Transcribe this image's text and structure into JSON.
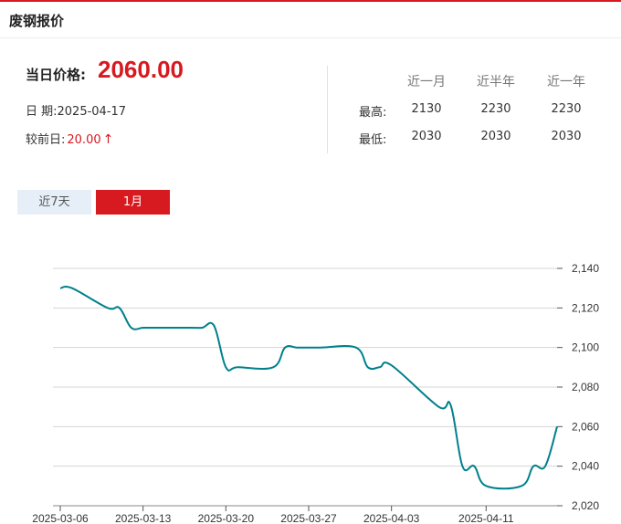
{
  "header": {
    "title": "废钢报价"
  },
  "price": {
    "label": "当日价格:",
    "value": "2060.00"
  },
  "date": {
    "label": "日 期:",
    "value": "2025-04-17"
  },
  "change": {
    "label": "较前日:",
    "value": "20.00",
    "arrow": "↑",
    "color": "#d71920"
  },
  "stats": {
    "columns": [
      "近一月",
      "近半年",
      "近一年"
    ],
    "rows": [
      {
        "label": "最高:",
        "values": [
          "2130",
          "2230",
          "2230"
        ]
      },
      {
        "label": "最低:",
        "values": [
          "2030",
          "2030",
          "2030"
        ]
      }
    ]
  },
  "tabs": [
    {
      "label": "近7天",
      "active": false
    },
    {
      "label": "1月",
      "active": true
    }
  ],
  "colors": {
    "accent": "#d71920",
    "line": "#00808b",
    "tab_inactive": "#e6eef7"
  },
  "chart_data": {
    "type": "line",
    "title": "",
    "xlabel": "",
    "ylabel": "",
    "ylim": [
      2020,
      2140
    ],
    "yticks": [
      2020,
      2040,
      2060,
      2080,
      2100,
      2120,
      2140
    ],
    "ytick_labels": [
      "2,020",
      "2,040",
      "2,060",
      "2,080",
      "2,100",
      "2,120",
      "2,140"
    ],
    "xtick_labels": [
      "2025-03-06",
      "2025-03-13",
      "2025-03-20",
      "2025-03-27",
      "2025-04-03",
      "2025-04-11"
    ],
    "grid": true,
    "legend": "none",
    "series": [
      {
        "x": [
          "2025-03-06",
          "2025-03-07",
          "2025-03-10",
          "2025-03-11",
          "2025-03-12",
          "2025-03-13",
          "2025-03-14",
          "2025-03-17",
          "2025-03-18",
          "2025-03-19",
          "2025-03-20",
          "2025-03-21",
          "2025-03-24",
          "2025-03-25",
          "2025-03-26",
          "2025-03-27",
          "2025-03-28",
          "2025-03-31",
          "2025-04-01",
          "2025-04-02",
          "2025-04-03",
          "2025-04-07",
          "2025-04-08",
          "2025-04-09",
          "2025-04-10",
          "2025-04-11",
          "2025-04-14",
          "2025-04-15",
          "2025-04-16",
          "2025-04-17"
        ],
        "values": [
          2130,
          2130,
          2120,
          2120,
          2110,
          2110,
          2110,
          2110,
          2110,
          2111,
          2090,
          2090,
          2090,
          2100,
          2100,
          2100,
          2100,
          2100,
          2090,
          2090,
          2091,
          2070,
          2071,
          2040,
          2040,
          2030,
          2030,
          2040,
          2040,
          2060
        ]
      }
    ]
  }
}
